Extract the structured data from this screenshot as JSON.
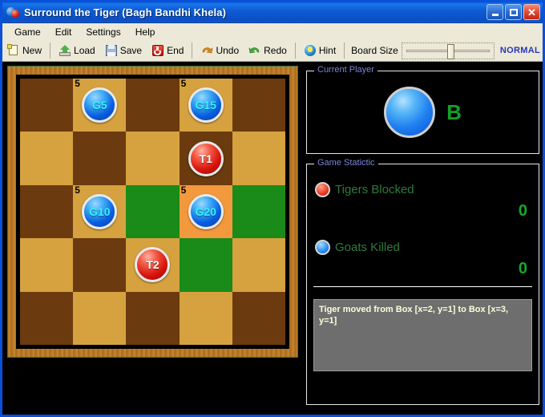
{
  "window": {
    "title": "Surround the Tiger (Bagh Bandhi Khela)",
    "icon": "tiger-goat-ball-icon",
    "minimize_label": "_",
    "maximize_label": "□",
    "close_label": "✕",
    "accent_color": "#0d5bd4"
  },
  "menubar": {
    "items": [
      {
        "label": "Game"
      },
      {
        "label": "Edit"
      },
      {
        "label": "Settings"
      },
      {
        "label": "Help"
      }
    ]
  },
  "toolbar": {
    "buttons": [
      {
        "label": "New",
        "icon": "new-page-icon"
      },
      {
        "label": "Load",
        "icon": "load-open-icon"
      },
      {
        "label": "Save",
        "icon": "save-floppy-icon"
      },
      {
        "label": "End",
        "icon": "power-end-icon"
      },
      {
        "label": "Undo",
        "icon": "undo-arrow-icon"
      },
      {
        "label": "Redo",
        "icon": "redo-arrow-icon"
      },
      {
        "label": "Hint",
        "icon": "hint-globe-icon"
      }
    ],
    "board_size": {
      "label": "Board Size",
      "value_label": "NORMAL",
      "slider_percent": 49
    }
  },
  "board": {
    "rows": 5,
    "cols": 5,
    "colors": {
      "dark_square": "#6b3a0e",
      "light_square": "#d6a23f",
      "valid_move": "#1a8a18",
      "selected": "#f2993d",
      "frame_wood": "#b5711f",
      "frame_border": "#2f7a4f"
    },
    "cells": [
      {
        "r": 0,
        "c": 0,
        "shade": "dark",
        "state": "none",
        "piece": null,
        "count": null
      },
      {
        "r": 0,
        "c": 1,
        "shade": "light",
        "state": "none",
        "piece": {
          "type": "goat",
          "label": "G5"
        },
        "count": "5"
      },
      {
        "r": 0,
        "c": 2,
        "shade": "dark",
        "state": "none",
        "piece": null,
        "count": null
      },
      {
        "r": 0,
        "c": 3,
        "shade": "light",
        "state": "none",
        "piece": {
          "type": "goat",
          "label": "G15"
        },
        "count": "5"
      },
      {
        "r": 0,
        "c": 4,
        "shade": "dark",
        "state": "none",
        "piece": null,
        "count": null
      },
      {
        "r": 1,
        "c": 0,
        "shade": "light",
        "state": "none",
        "piece": null,
        "count": null
      },
      {
        "r": 1,
        "c": 1,
        "shade": "dark",
        "state": "none",
        "piece": null,
        "count": null
      },
      {
        "r": 1,
        "c": 2,
        "shade": "light",
        "state": "none",
        "piece": null,
        "count": null
      },
      {
        "r": 1,
        "c": 3,
        "shade": "dark",
        "state": "none",
        "piece": {
          "type": "tiger",
          "label": "T1"
        },
        "count": null
      },
      {
        "r": 1,
        "c": 4,
        "shade": "light",
        "state": "none",
        "piece": null,
        "count": null
      },
      {
        "r": 2,
        "c": 0,
        "shade": "dark",
        "state": "none",
        "piece": null,
        "count": null
      },
      {
        "r": 2,
        "c": 1,
        "shade": "light",
        "state": "none",
        "piece": {
          "type": "goat",
          "label": "G10"
        },
        "count": "5"
      },
      {
        "r": 2,
        "c": 2,
        "shade": "dark",
        "state": "move",
        "piece": null,
        "count": null
      },
      {
        "r": 2,
        "c": 3,
        "shade": "light",
        "state": "sel",
        "piece": {
          "type": "goat",
          "label": "G20"
        },
        "count": "5"
      },
      {
        "r": 2,
        "c": 4,
        "shade": "dark",
        "state": "move",
        "piece": null,
        "count": null
      },
      {
        "r": 3,
        "c": 0,
        "shade": "light",
        "state": "none",
        "piece": null,
        "count": null
      },
      {
        "r": 3,
        "c": 1,
        "shade": "dark",
        "state": "none",
        "piece": null,
        "count": null
      },
      {
        "r": 3,
        "c": 2,
        "shade": "light",
        "state": "none",
        "piece": {
          "type": "tiger",
          "label": "T2"
        },
        "count": null
      },
      {
        "r": 3,
        "c": 3,
        "shade": "dark",
        "state": "move",
        "piece": null,
        "count": null
      },
      {
        "r": 3,
        "c": 4,
        "shade": "light",
        "state": "none",
        "piece": null,
        "count": null
      },
      {
        "r": 4,
        "c": 0,
        "shade": "dark",
        "state": "none",
        "piece": null,
        "count": null
      },
      {
        "r": 4,
        "c": 1,
        "shade": "light",
        "state": "none",
        "piece": null,
        "count": null
      },
      {
        "r": 4,
        "c": 2,
        "shade": "dark",
        "state": "none",
        "piece": null,
        "count": null
      },
      {
        "r": 4,
        "c": 3,
        "shade": "light",
        "state": "none",
        "piece": null,
        "count": null
      },
      {
        "r": 4,
        "c": 4,
        "shade": "dark",
        "state": "none",
        "piece": null,
        "count": null
      }
    ]
  },
  "current_player": {
    "group_title": "Current Player",
    "letter": "B",
    "letter_color": "#12a028",
    "piece_icon": "goat-ball-icon"
  },
  "game_statistic": {
    "group_title": "Game Statictic",
    "tigers_blocked": {
      "label": "Tigers Blocked",
      "value": "0",
      "icon": "tiger-dot-icon"
    },
    "goats_killed": {
      "label": "Goats Killed",
      "value": "0",
      "icon": "goat-dot-icon"
    }
  },
  "status": {
    "message": "Tiger moved from Box [x=2, y=1] to Box [x=3, y=1]"
  }
}
